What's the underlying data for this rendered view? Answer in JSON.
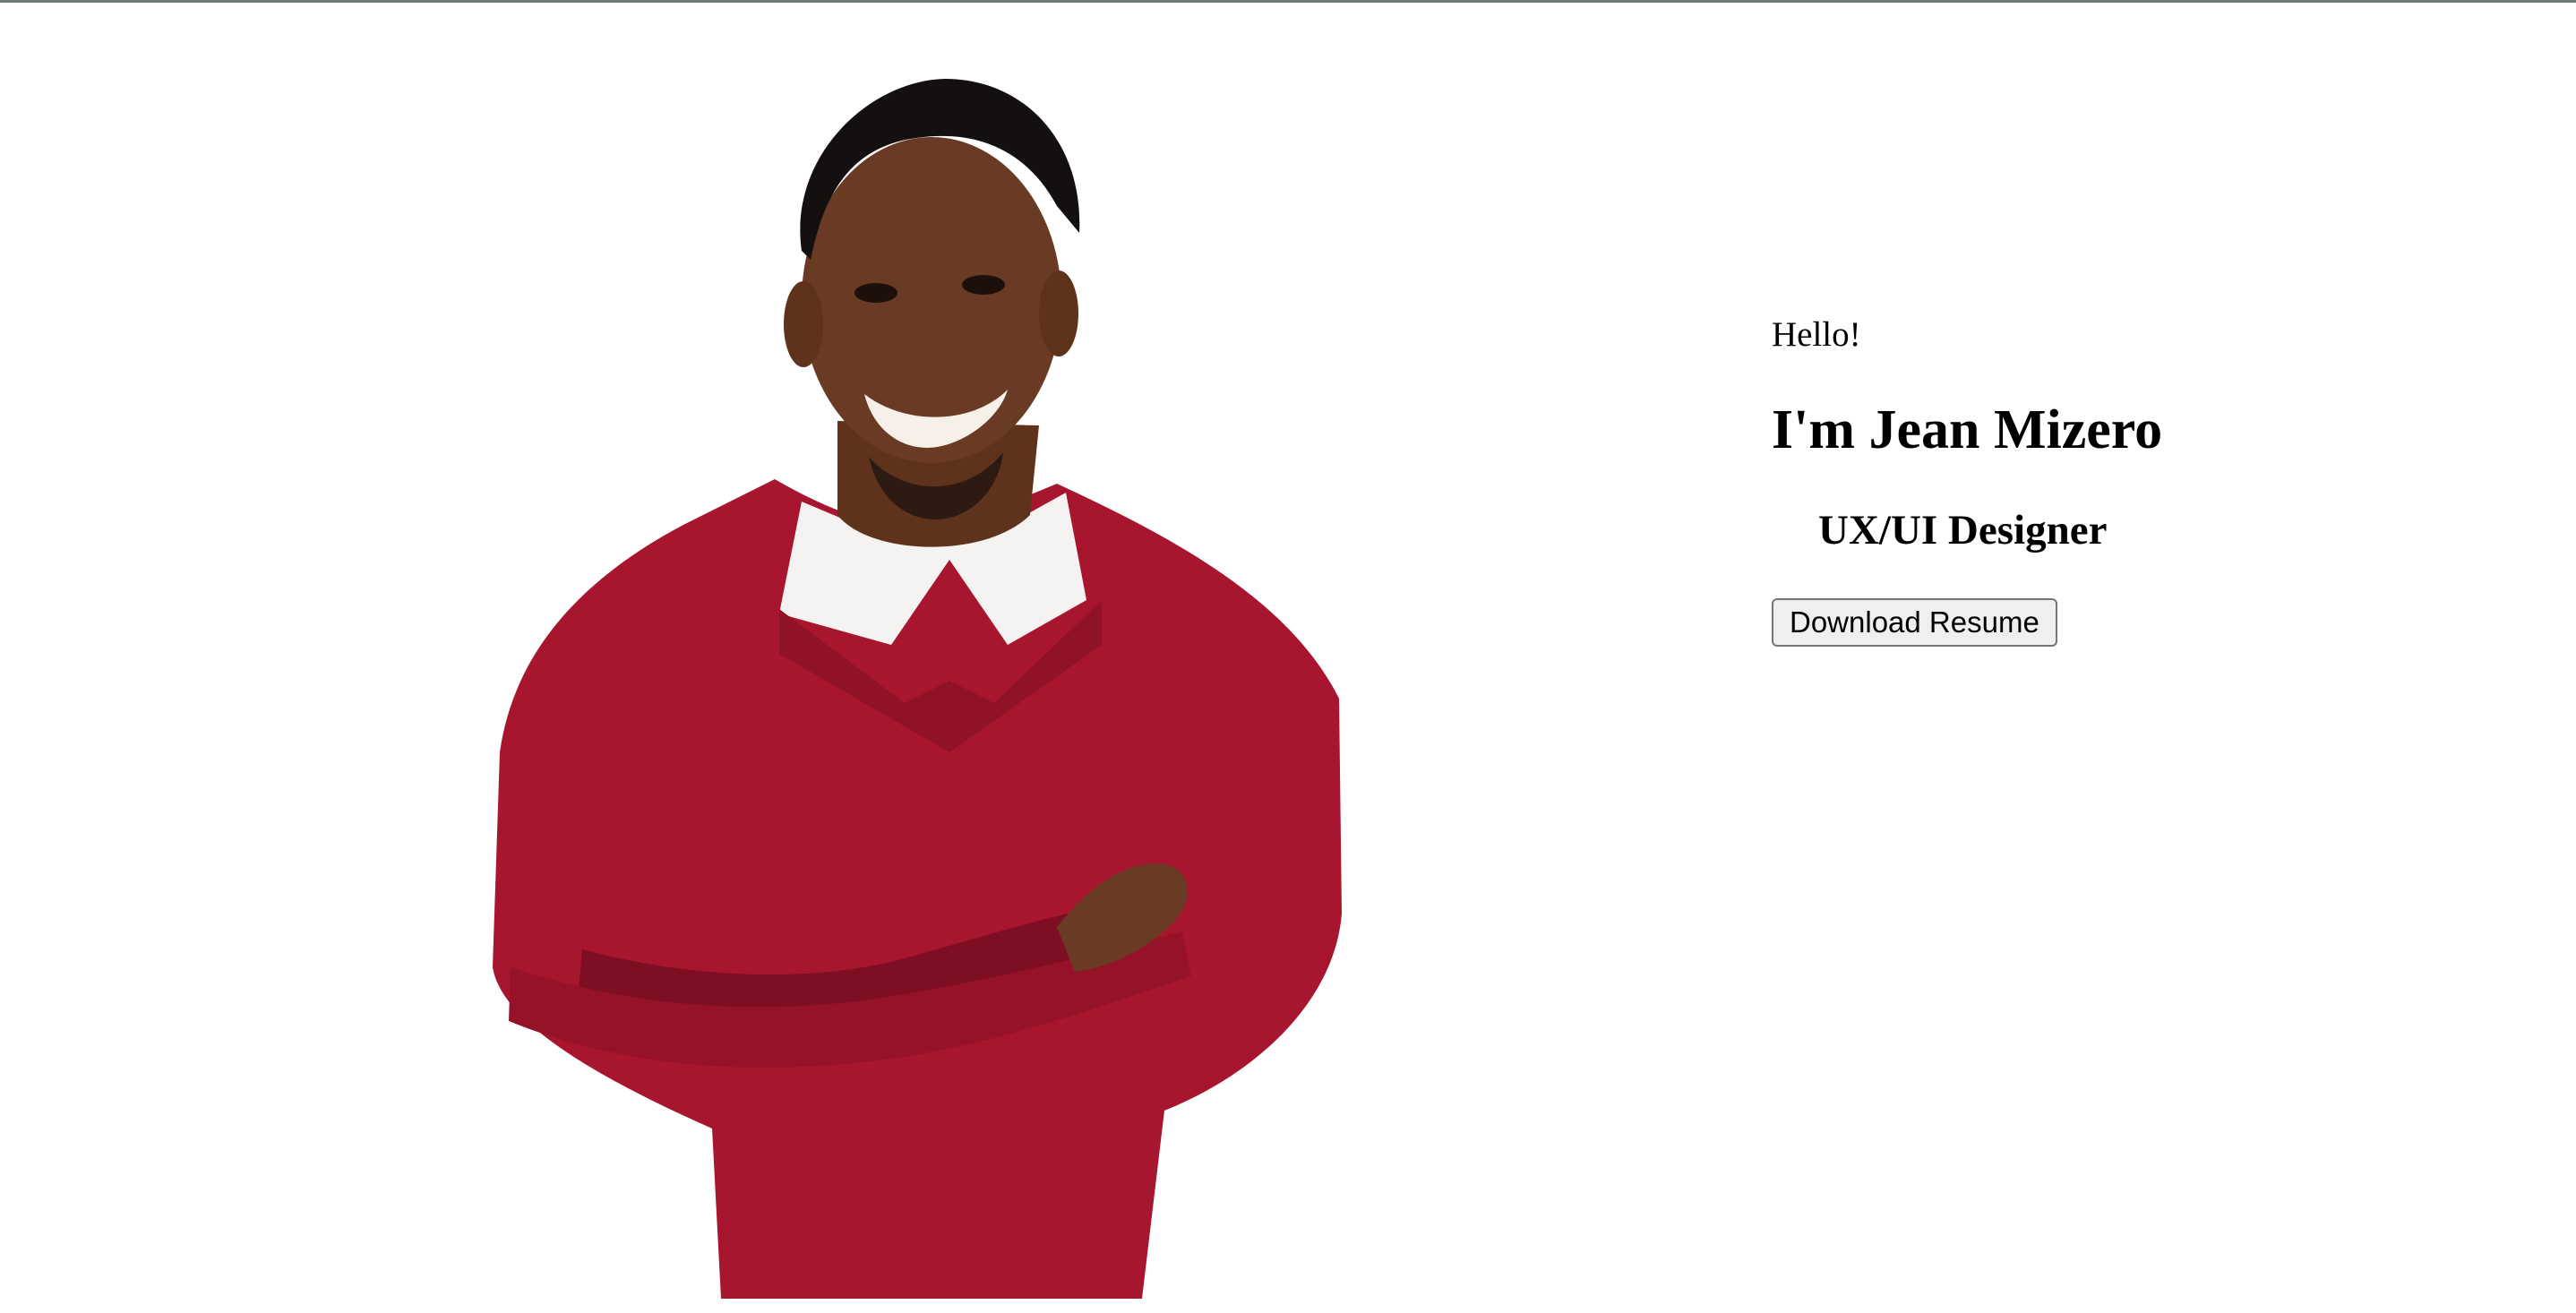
{
  "hero": {
    "greeting": "Hello!",
    "name_line": "I'm Jean Mizero",
    "role": "UX/UI Designer",
    "download_button_label": "Download Resume"
  },
  "portrait": {
    "subject": "smiling man with crossed arms",
    "colors": {
      "sweater": "#a8152f",
      "sweater_shadow": "#7e0f22",
      "skin": "#6a3b24",
      "hair": "#151010",
      "collar": "#f4f3f1"
    }
  },
  "colors": {
    "page_background": "#ffffff",
    "top_rule": "#6f7a79",
    "text": "#000000",
    "button_background": "#efefef",
    "button_border": "#767676"
  }
}
